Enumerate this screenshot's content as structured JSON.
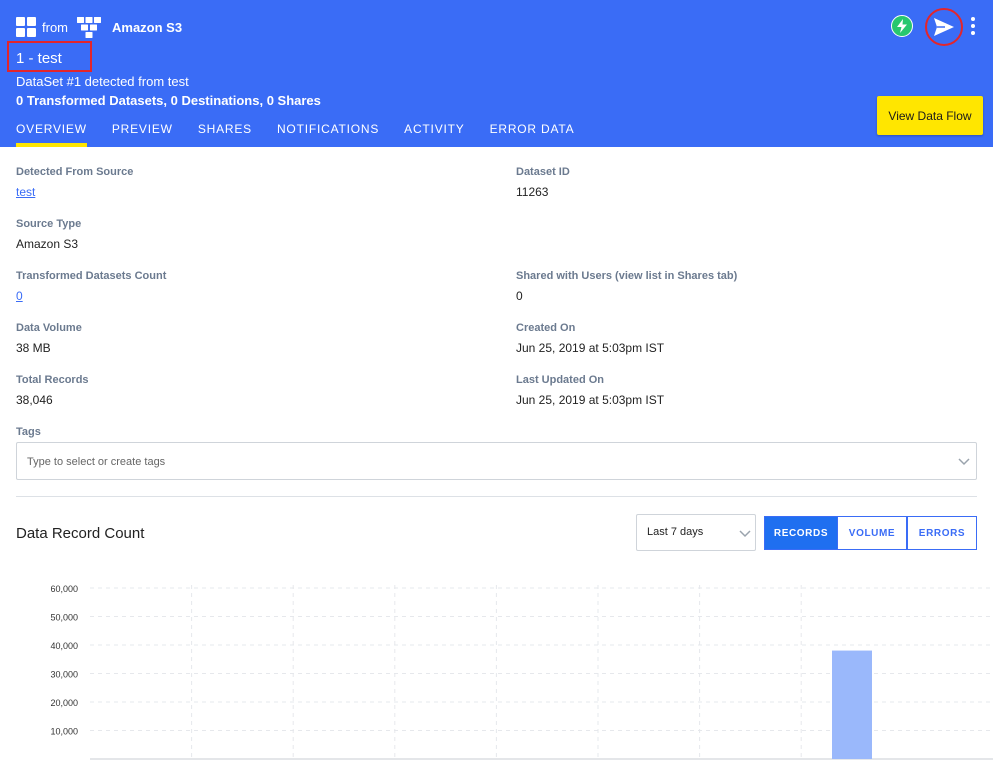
{
  "header": {
    "from_label": "from",
    "source_name": "Amazon S3",
    "title": "1 - test",
    "subtitle": "DataSet #1 detected from test",
    "stats": "0 Transformed Datasets, 0 Destinations, 0 Shares",
    "view_flow_label": "View Data Flow"
  },
  "tabs": [
    {
      "label": "OVERVIEW",
      "active": true
    },
    {
      "label": "PREVIEW"
    },
    {
      "label": "SHARES"
    },
    {
      "label": "NOTIFICATIONS"
    },
    {
      "label": "ACTIVITY"
    },
    {
      "label": "ERROR DATA"
    }
  ],
  "fields": {
    "detected_from_source": {
      "label": "Detected From Source",
      "value": "test"
    },
    "dataset_id": {
      "label": "Dataset ID",
      "value": "11263"
    },
    "source_type": {
      "label": "Source Type",
      "value": "Amazon S3"
    },
    "transformed_count": {
      "label": "Transformed Datasets Count",
      "value": "0"
    },
    "shared_with": {
      "label": "Shared with Users (view list in Shares tab)",
      "value": "0"
    },
    "data_volume": {
      "label": "Data Volume",
      "value": "38 MB"
    },
    "created_on": {
      "label": "Created On",
      "value": "Jun 25, 2019 at 5:03pm IST"
    },
    "total_records": {
      "label": "Total Records",
      "value": "38,046"
    },
    "last_updated": {
      "label": "Last Updated On",
      "value": "Jun 25, 2019 at 5:03pm IST"
    }
  },
  "tags": {
    "label": "Tags",
    "placeholder": "Type to select or create tags"
  },
  "record_section": {
    "title": "Data Record Count",
    "range_value": "Last 7 days",
    "buttons": {
      "records": "RECORDS",
      "volume": "VOLUME",
      "errors": "ERRORS"
    }
  },
  "colors": {
    "header_bg": "#3a6cf6",
    "accent_yellow": "#ffe600",
    "bar": "#9ab8fb",
    "bolt_green": "#28c76f"
  },
  "chart_data": {
    "type": "bar",
    "ylim": [
      0,
      60000
    ],
    "y_ticks": [
      "60,000",
      "50,000",
      "40,000",
      "30,000",
      "20,000",
      "10,000"
    ],
    "y_tick_values": [
      60000,
      50000,
      40000,
      30000,
      20000,
      10000
    ],
    "values": [
      0,
      0,
      0,
      0,
      0,
      0,
      0,
      38046
    ],
    "grid": true
  }
}
